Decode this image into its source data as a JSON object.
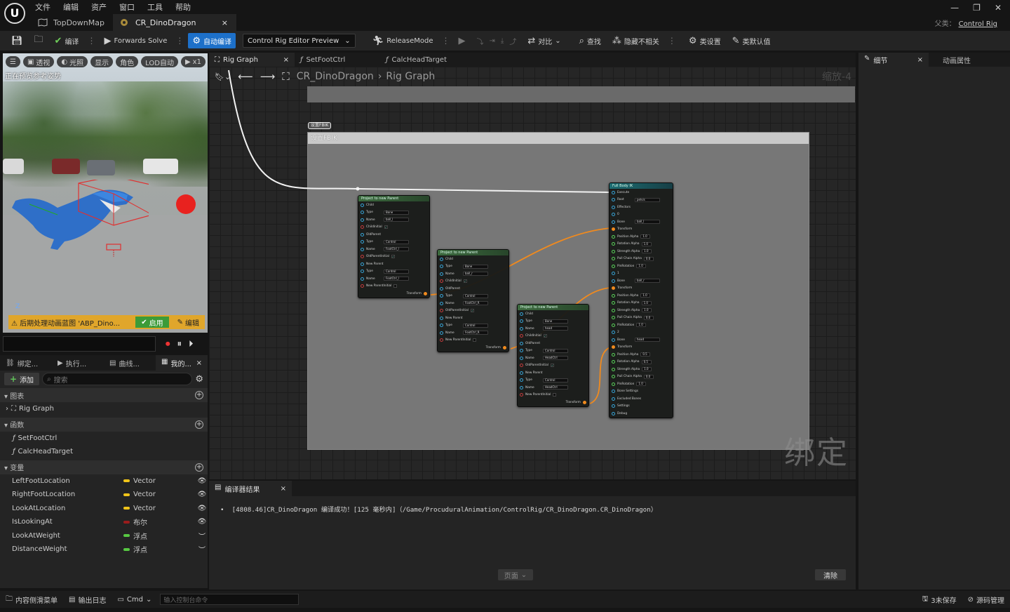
{
  "menu": {
    "items": [
      "文件",
      "编辑",
      "资产",
      "窗口",
      "工具",
      "帮助"
    ]
  },
  "doc_tabs": [
    {
      "label": "TopDownMap",
      "icon": "map-icon"
    },
    {
      "label": "CR_DinoDragon",
      "icon": "control-rig-icon",
      "close": "×"
    }
  ],
  "window_controls": {
    "minimize": "—",
    "restore": "❐",
    "close": "✕"
  },
  "parent_class": {
    "label": "父类：",
    "value": "Control Rig"
  },
  "toolbar": {
    "compile_label": "编译",
    "forwards_solve_label": "Forwards Solve",
    "auto_compile_label": "自动编译",
    "preview_select_value": "Control Rig Editor Preview",
    "release_mode_label": "ReleaseMode",
    "diff_label": "对比",
    "find_label": "查找",
    "hide_unrelated_label": "隐藏不相关",
    "class_settings_label": "类设置",
    "class_defaults_label": "类默认值"
  },
  "viewport": {
    "chips": [
      "透视",
      "光照",
      "显示",
      "角色",
      "LOD自动",
      "x1"
    ],
    "status_text": "正在预览参考姿势",
    "warning_text": "后期处理动画蓝图 'ABP_Dino...",
    "enable_label": "启用",
    "edit_label": "编辑",
    "axis_label": "Z"
  },
  "blueprint_panel": {
    "tabs": [
      {
        "label": "绑定...",
        "icon": "rig-hierarchy-icon"
      },
      {
        "label": "执行...",
        "icon": "execution-stack-icon"
      },
      {
        "label": "曲线...",
        "icon": "curve-icon"
      },
      {
        "label": "我的...",
        "icon": "my-blueprint-icon",
        "close": "×"
      }
    ],
    "add_label": "添加",
    "search_placeholder": "搜索",
    "sections": {
      "graphs": {
        "title": "图表",
        "items": [
          "Rig Graph"
        ]
      },
      "functions": {
        "title": "函数",
        "items": [
          "SetFootCtrl",
          "CalcHeadTarget"
        ]
      },
      "variables": {
        "title": "变量",
        "items": [
          {
            "name": "LeftFootLocation",
            "type": "Vector",
            "color": "#f0c419",
            "visibility": "visible"
          },
          {
            "name": "RightFootLocation",
            "type": "Vector",
            "color": "#f0c419",
            "visibility": "visible"
          },
          {
            "name": "LookAtLocation",
            "type": "Vector",
            "color": "#f0c419",
            "visibility": "visible"
          },
          {
            "name": "IsLookingAt",
            "type": "布尔",
            "color": "#9a1c1c",
            "visibility": "visible"
          },
          {
            "name": "LookAtWeight",
            "type": "浮点",
            "color": "#57c842",
            "visibility": "hidden"
          },
          {
            "name": "DistanceWeight",
            "type": "浮点",
            "color": "#57c842",
            "visibility": "hidden"
          }
        ]
      }
    }
  },
  "graph_tabs": [
    {
      "label": "Rig Graph",
      "close": "×"
    },
    {
      "label": "SetFootCtrl"
    },
    {
      "label": "CalcHeadTarget"
    }
  ],
  "graph": {
    "breadcrumb": [
      "CR_DinoDragon",
      "Rig Graph"
    ],
    "zoom": "缩放-4",
    "comment_title": "设置FBIK",
    "comment_tag": "设置FBIK",
    "watermark": "绑定",
    "nodes": [
      {
        "title": "Project to new Parent",
        "rows": [
          {
            "pin": "blue",
            "label": "Child"
          },
          {
            "pin": "blue",
            "label": "Type",
            "value": "Bone"
          },
          {
            "pin": "blue",
            "label": "Name",
            "value": "ball_l"
          },
          {
            "pin": "red",
            "label": "ChildInitial",
            "check": true
          },
          {
            "pin": "blue",
            "label": "OldParent"
          },
          {
            "pin": "blue",
            "label": "Type",
            "value": "Control"
          },
          {
            "pin": "blue",
            "label": "Name",
            "value": "FootCtrl_l"
          },
          {
            "pin": "red",
            "label": "OldParentInitial",
            "check": true
          },
          {
            "pin": "blue",
            "label": "New Parent"
          },
          {
            "pin": "blue",
            "label": "Type",
            "value": "Control"
          },
          {
            "pin": "blue",
            "label": "Name",
            "value": "FootCtrl_l"
          },
          {
            "pin": "red",
            "label": "New ParentInitial",
            "check": false
          },
          {
            "pin": "orange",
            "label": "Transform",
            "output": true
          }
        ]
      },
      {
        "title": "Project to new Parent",
        "rows": [
          {
            "pin": "blue",
            "label": "Child"
          },
          {
            "pin": "blue",
            "label": "Type",
            "value": "Bone"
          },
          {
            "pin": "blue",
            "label": "Name",
            "value": "ball_r"
          },
          {
            "pin": "red",
            "label": "ChildInitial",
            "check": true
          },
          {
            "pin": "blue",
            "label": "OldParent"
          },
          {
            "pin": "blue",
            "label": "Type",
            "value": "Control"
          },
          {
            "pin": "blue",
            "label": "Name",
            "value": "FootCtrl_R"
          },
          {
            "pin": "red",
            "label": "OldParentInitial",
            "check": true
          },
          {
            "pin": "blue",
            "label": "New Parent"
          },
          {
            "pin": "blue",
            "label": "Type",
            "value": "Control"
          },
          {
            "pin": "blue",
            "label": "Name",
            "value": "FootCtrl_R"
          },
          {
            "pin": "red",
            "label": "New ParentInitial",
            "check": false
          },
          {
            "pin": "orange",
            "label": "Transform",
            "output": true
          }
        ]
      },
      {
        "title": "Project to new Parent",
        "rows": [
          {
            "pin": "blue",
            "label": "Child"
          },
          {
            "pin": "blue",
            "label": "Type",
            "value": "Bone"
          },
          {
            "pin": "blue",
            "label": "Name",
            "value": "head"
          },
          {
            "pin": "red",
            "label": "ChildInitial",
            "check": true
          },
          {
            "pin": "blue",
            "label": "OldParent"
          },
          {
            "pin": "blue",
            "label": "Type",
            "value": "Control"
          },
          {
            "pin": "blue",
            "label": "Name",
            "value": "HeadCtrl"
          },
          {
            "pin": "red",
            "label": "OldParentInitial",
            "check": true
          },
          {
            "pin": "blue",
            "label": "New Parent"
          },
          {
            "pin": "blue",
            "label": "Type",
            "value": "Control"
          },
          {
            "pin": "blue",
            "label": "Name",
            "value": "HeadCtrl"
          },
          {
            "pin": "red",
            "label": "New ParentInitial",
            "check": false
          },
          {
            "pin": "orange",
            "label": "Transform",
            "output": true
          }
        ]
      },
      {
        "title": "Full Body IK",
        "rows": [
          {
            "pin": "blue",
            "label": "Execute"
          },
          {
            "pin": "blue",
            "label": "Root",
            "value": "pelvis"
          },
          {
            "pin": "blue",
            "label": "Effectors"
          },
          {
            "pin": "blue",
            "label": "0"
          },
          {
            "pin": "blue",
            "label": "Bone",
            "value": "ball_l"
          },
          {
            "pin": "orange",
            "label": "Transform"
          },
          {
            "pin": "green",
            "label": "Position Alpha",
            "value": "1.0"
          },
          {
            "pin": "green",
            "label": "Rotation Alpha",
            "value": "1.0"
          },
          {
            "pin": "green",
            "label": "Strength Alpha",
            "value": "1.0"
          },
          {
            "pin": "green",
            "label": "Pull Chain Alpha",
            "value": "0.0"
          },
          {
            "pin": "green",
            "label": "PinRotation",
            "value": "1.0"
          },
          {
            "pin": "blue",
            "label": "1"
          },
          {
            "pin": "blue",
            "label": "Bone",
            "value": "ball_r"
          },
          {
            "pin": "orange",
            "label": "Transform"
          },
          {
            "pin": "green",
            "label": "Position Alpha",
            "value": "1.0"
          },
          {
            "pin": "green",
            "label": "Rotation Alpha",
            "value": "1.0"
          },
          {
            "pin": "green",
            "label": "Strength Alpha",
            "value": "1.0"
          },
          {
            "pin": "green",
            "label": "Pull Chain Alpha",
            "value": "0.0"
          },
          {
            "pin": "green",
            "label": "PinRotation",
            "value": "1.0"
          },
          {
            "pin": "blue",
            "label": "2"
          },
          {
            "pin": "blue",
            "label": "Bone",
            "value": "head"
          },
          {
            "pin": "orange",
            "label": "Transform"
          },
          {
            "pin": "green",
            "label": "Position Alpha",
            "value": "0.5"
          },
          {
            "pin": "green",
            "label": "Rotation Alpha",
            "value": "0.5"
          },
          {
            "pin": "green",
            "label": "Strength Alpha",
            "value": "1.0"
          },
          {
            "pin": "green",
            "label": "Pull Chain Alpha",
            "value": "0.0"
          },
          {
            "pin": "green",
            "label": "PinRotation",
            "value": "1.0"
          },
          {
            "pin": "blue",
            "label": "Bone Settings"
          },
          {
            "pin": "blue",
            "label": "Excluded Bones"
          },
          {
            "pin": "blue",
            "label": "Settings"
          },
          {
            "pin": "blue",
            "label": "Debug"
          }
        ]
      }
    ]
  },
  "compiler": {
    "tab_label": "编译器结果",
    "message": "[4808.46]CR_DinoDragon 编译成功！[125 毫秒内]（/Game/ProcuduralAnimation/ControlRig/CR_DinoDragon.CR_DinoDragon）",
    "page_label": "页面",
    "clear_label": "清除"
  },
  "right_panel": {
    "tabs": [
      {
        "label": "细节",
        "close": "×"
      },
      {
        "label": "动画属性"
      }
    ]
  },
  "statusbar": {
    "content_drawer": "内容侧滑菜单",
    "output_log": "输出日志",
    "cmd_label": "Cmd",
    "console_placeholder": "输入控制台命令",
    "unsaved": "3未保存",
    "source_control": "源码管理"
  }
}
